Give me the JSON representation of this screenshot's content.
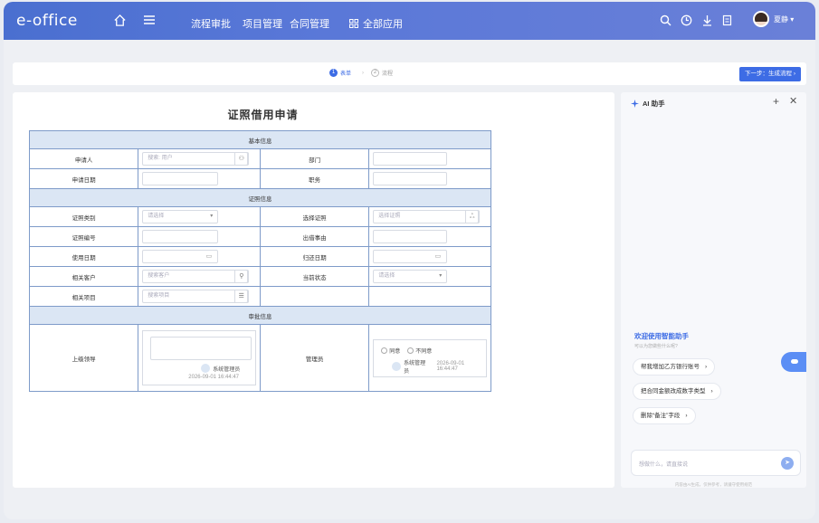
{
  "header": {
    "logo": "e-office",
    "nav": [
      "流程审批",
      "项目管理",
      "合同管理"
    ],
    "all_apps": "全部应用",
    "username": "夏静"
  },
  "steps": {
    "step1_num": "1",
    "step1_label": "表单",
    "step2_num": "2",
    "step2_label": "流程",
    "sep": "›",
    "next_button": "下一步：生成流程 ›"
  },
  "form": {
    "title": "证照借用申请",
    "sections": {
      "basic": "基本信息",
      "cert": "证照信息",
      "approval": "审批信息"
    },
    "labels": {
      "applicant": "申请人",
      "department": "部门",
      "apply_date": "申请日期",
      "position": "职务",
      "cert_type": "证照类别",
      "select_cert": "选择证照",
      "cert_no": "证照编号",
      "borrow_reason": "出借事由",
      "use_date": "使用日期",
      "return_date": "归还日期",
      "customer": "相关客户",
      "status": "当前状态",
      "project": "相关项目",
      "superior": "上级领导",
      "admin": "管理员"
    },
    "placeholders": {
      "applicant": "搜索: 用户",
      "cert_type": "请选择",
      "select_cert": "选择证照",
      "customer": "搜索客户",
      "status": "请选择",
      "project": "搜索项目"
    },
    "approval": {
      "signer": "系统管理员",
      "date1": "2026-09-01 16:44:47",
      "agree": "同意",
      "disagree": "不同意",
      "date2": "2026-09-01 16:44:47"
    }
  },
  "ai": {
    "title": "AI 助手",
    "welcome": "欢迎使用智能助手",
    "welcome_sub": "可以为您做些什么呢?",
    "suggestions": [
      "帮我增加乙方银行账号",
      "把合同金额改成数字类型",
      "删除“备注”字段"
    ],
    "input_placeholder": "想做什么，请直接说",
    "disclaimer": "内容由AI生成，仅供参考，请遵守使用规范"
  },
  "colors": {
    "brand": "#4a6fd0",
    "accent": "#3d6ce5",
    "section_bg": "#dbe6f4"
  }
}
